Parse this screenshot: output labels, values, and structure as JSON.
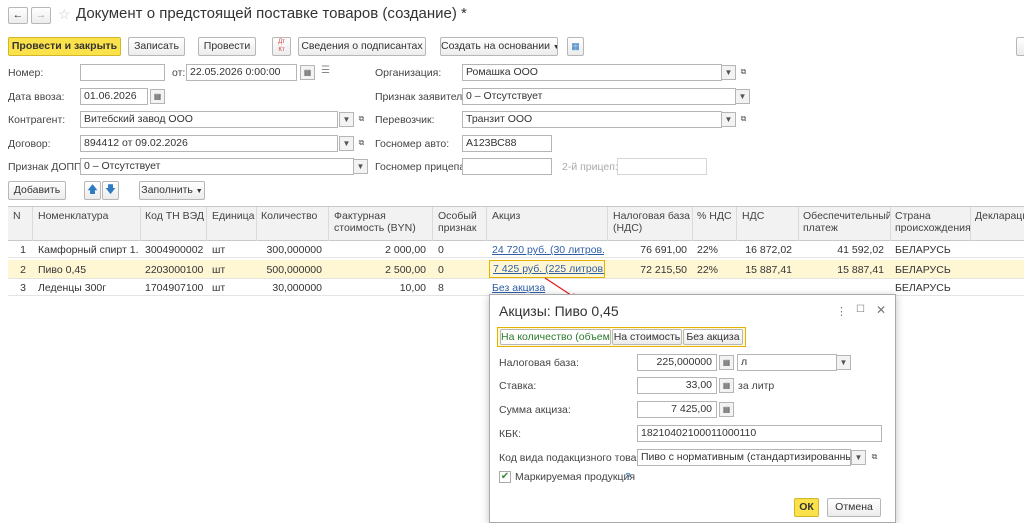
{
  "title": "Документ о предстоящей поставке товаров (создание) *",
  "toolbar": {
    "post_close": "Провести и закрыть",
    "save": "Записать",
    "post": "Провести",
    "dt_kt": "Дт Кт",
    "signers": "Сведения о подписантах",
    "create_based": "Создать на основании",
    "more_icon": "table-icon"
  },
  "form": {
    "number_label": "Номер:",
    "number_value": "",
    "from_label": "от:",
    "date_value": "22.05.2026  0:00:00",
    "org_label": "Организация:",
    "org_value": "Ромашка ООО",
    "import_date_label": "Дата ввоза:",
    "import_date_value": "01.06.2026",
    "declarant_label": "Признак заявителя:",
    "declarant_value": "0 – Отсутствует",
    "counterparty_label": "Контрагент:",
    "counterparty_value": "Витебский завод ООО",
    "carrier_label": "Перевозчик:",
    "carrier_value": "Транзит ООО",
    "contract_label": "Договор:",
    "contract_value": "894412 от 09.02.2026",
    "auto_label": "Госномер авто:",
    "auto_value": "А123ВС88",
    "dopp_label": "Признак ДОПП:",
    "dopp_value": "0 – Отсутствует",
    "trailer_label": "Госномер прицепа:",
    "trailer_value": "",
    "trailer2_label": "2-й прицеп:",
    "trailer2_value": ""
  },
  "table_toolbar": {
    "add": "Добавить",
    "fill": "Заполнить"
  },
  "table": {
    "headers": [
      "N",
      "Номенклатура",
      "Код ТН ВЭД",
      "Единица",
      "Количество",
      "Фактурная стоимость (BYN)",
      "Особый признак",
      "Акциз",
      "Налоговая база (НДС)",
      "% НДС",
      "НДС",
      "Обеспечительный платеж",
      "Страна происхождения",
      "Деклараци"
    ],
    "rows": [
      [
        "1",
        "Камфорный спирт 1...",
        "3004900002",
        "шт",
        "300,000000",
        "2 000,00",
        "0",
        "24 720 руб. (30 литров...",
        "76 691,00",
        "22%",
        "16 872,02",
        "41 592,02",
        "БЕЛАРУСЬ"
      ],
      [
        "2",
        "Пиво 0,45",
        "2203000100",
        "шт",
        "500,000000",
        "2 500,00",
        "0",
        "7 425 руб. (225 литров...",
        "72 215,50",
        "22%",
        "15 887,41",
        "15 887,41",
        "БЕЛАРУСЬ"
      ],
      [
        "3",
        "Леденцы 300г",
        "1704907100",
        "шт",
        "30,000000",
        "10,00",
        "8",
        "Без акциза",
        "",
        "",
        "",
        "",
        "БЕЛАРУСЬ"
      ]
    ]
  },
  "dialog": {
    "title": "Акцизы: Пиво 0,45",
    "tabs": [
      "На количество (объем)",
      "На стоимость",
      "Без акциза"
    ],
    "tax_base_label": "Налоговая база:",
    "tax_base_value": "225,000000",
    "unit_value": "л",
    "rate_label": "Ставка:",
    "rate_value": "33,00",
    "rate_unit": "за литр",
    "excise_sum_label": "Сумма акциза:",
    "excise_sum_value": "7 425,00",
    "kbk_label": "КБК:",
    "kbk_value": "18210402100011000110",
    "goods_code_label": "Код вида подакцизного товара:",
    "goods_code_value": "Пиво с нормативным (стандартизированным) со",
    "marked_label": "Маркируемая продукция",
    "help": "?",
    "ok": "ОК",
    "cancel": "Отмена"
  }
}
